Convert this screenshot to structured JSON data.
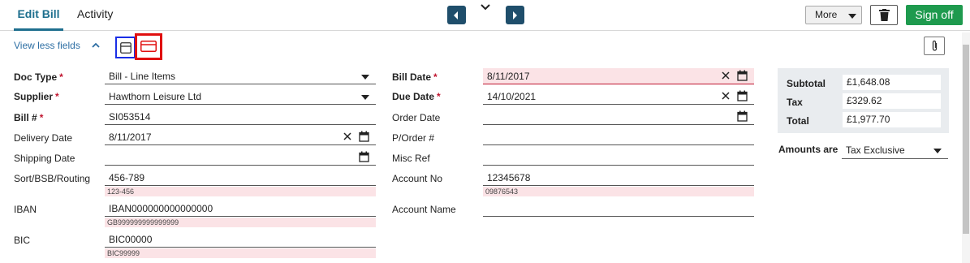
{
  "tabs": [
    {
      "label": "Edit Bill",
      "active": true
    },
    {
      "label": "Activity",
      "active": false
    }
  ],
  "header": {
    "more_label": "More",
    "signoff_label": "Sign off"
  },
  "toolbar": {
    "view_less_label": "View less fields"
  },
  "left_fields": {
    "doc_type": {
      "label": "Doc Type",
      "value": "Bill - Line Items"
    },
    "supplier": {
      "label": "Supplier",
      "value": "Hawthorn Leisure Ltd"
    },
    "bill_no": {
      "label": "Bill #",
      "value": "SI053514"
    },
    "delivery_date": {
      "label": "Delivery Date",
      "value": "8/11/2017"
    },
    "shipping_date": {
      "label": "Shipping Date",
      "value": ""
    },
    "sort_code": {
      "label": "Sort/BSB/Routing",
      "value": "456-789",
      "hint": "123-456"
    },
    "iban": {
      "label": "IBAN",
      "value": "IBAN000000000000000",
      "hint": "GB999999999999999"
    },
    "bic": {
      "label": "BIC",
      "value": "BIC00000",
      "hint": "BIC99999"
    }
  },
  "mid_fields": {
    "bill_date": {
      "label": "Bill Date",
      "value": "8/11/2017"
    },
    "due_date": {
      "label": "Due Date",
      "value": "14/10/2021"
    },
    "order_date": {
      "label": "Order Date",
      "value": ""
    },
    "po_number": {
      "label": "P/Order #",
      "value": ""
    },
    "misc_ref": {
      "label": "Misc Ref",
      "value": ""
    },
    "account_no": {
      "label": "Account No",
      "value": "12345678",
      "hint": "09876543"
    },
    "account_name": {
      "label": "Account Name",
      "value": ""
    }
  },
  "totals": {
    "subtotal_label": "Subtotal",
    "subtotal_value": "£1,648.08",
    "tax_label": "Tax",
    "tax_value": "£329.62",
    "total_label": "Total",
    "total_value": "£1,977.70"
  },
  "amounts": {
    "label": "Amounts are",
    "value": "Tax Exclusive"
  },
  "colors": {
    "accent": "#1e6f8e",
    "nav_button": "#1f4e6b",
    "signoff": "#1e9a4e",
    "error_bg": "#fbe3e6",
    "required": "#c0152f",
    "link": "#2d6ea3"
  },
  "icons": [
    "chevron-left-icon",
    "chevron-down-icon",
    "chevron-right-icon",
    "dropdown-arrow-icon",
    "trash-icon",
    "chevron-up-icon",
    "layout-compact-icon",
    "layout-expanded-icon",
    "paperclip-icon",
    "clear-icon",
    "calendar-icon"
  ]
}
